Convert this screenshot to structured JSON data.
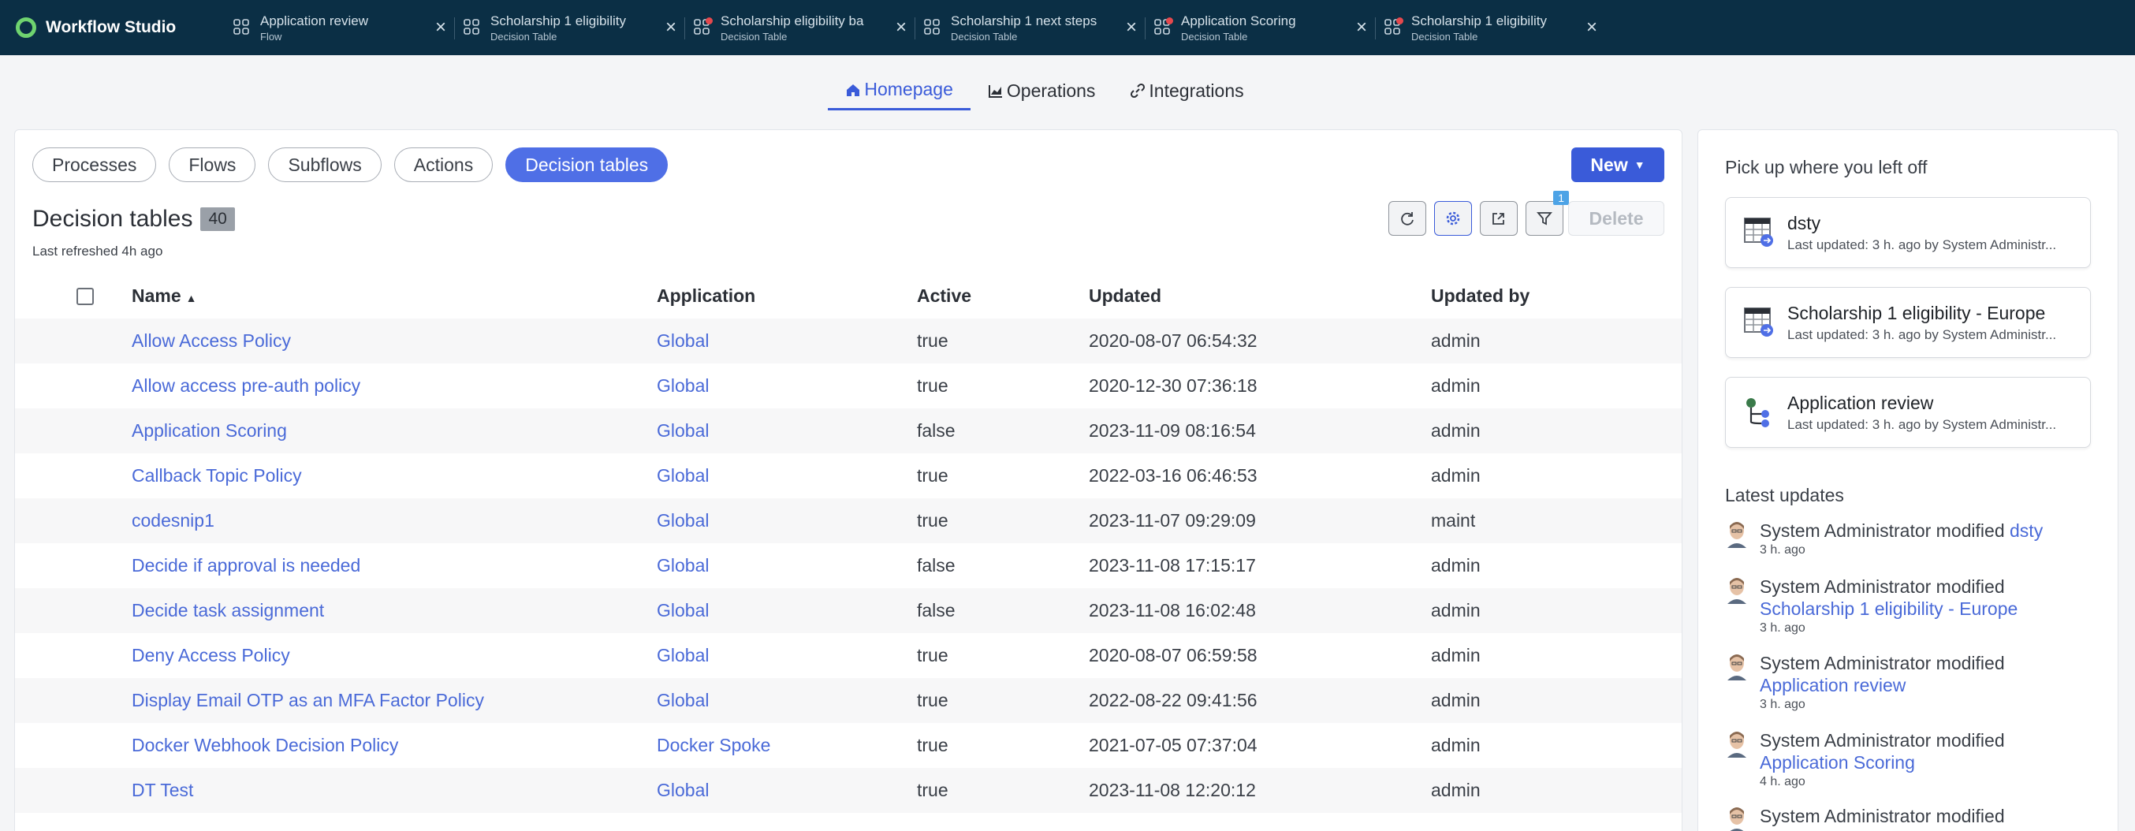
{
  "app": {
    "name": "Workflow Studio"
  },
  "tabs": [
    {
      "title": "Application review",
      "subtitle": "Flow",
      "icon": "flow-icon",
      "dot": false
    },
    {
      "title": "Scholarship 1 eligibility",
      "subtitle": "Decision Table",
      "icon": "decision-table-icon",
      "dot": false
    },
    {
      "title": "Scholarship eligibility ba",
      "subtitle": "Decision Table",
      "icon": "decision-table-icon",
      "dot": true
    },
    {
      "title": "Scholarship 1 next steps",
      "subtitle": "Decision Table",
      "icon": "decision-table-icon",
      "dot": false
    },
    {
      "title": "Application Scoring",
      "subtitle": "Decision Table",
      "icon": "decision-table-icon",
      "dot": true
    },
    {
      "title": "Scholarship 1 eligibility",
      "subtitle": "Decision Table",
      "icon": "decision-table-icon",
      "dot": true
    }
  ],
  "nav": {
    "items": [
      {
        "label": "Homepage",
        "icon": "home-icon",
        "active": true
      },
      {
        "label": "Operations",
        "icon": "chart-icon",
        "active": false
      },
      {
        "label": "Integrations",
        "icon": "link-icon",
        "active": false
      }
    ]
  },
  "filters": {
    "pills": [
      "Processes",
      "Flows",
      "Subflows",
      "Actions",
      "Decision tables"
    ],
    "active": "Decision tables"
  },
  "toolbar": {
    "new_label": "New",
    "delete_label": "Delete",
    "filter_count": "1"
  },
  "list": {
    "title": "Decision tables",
    "count": "40",
    "last_refreshed": "Last refreshed 4h ago",
    "columns": {
      "name": "Name",
      "application": "Application",
      "active": "Active",
      "updated": "Updated",
      "updated_by": "Updated by"
    },
    "rows": [
      {
        "name": "Allow Access Policy",
        "application": "Global",
        "active": "true",
        "updated": "2020-08-07 06:54:32",
        "updated_by": "admin"
      },
      {
        "name": "Allow access pre-auth policy",
        "application": "Global",
        "active": "true",
        "updated": "2020-12-30 07:36:18",
        "updated_by": "admin"
      },
      {
        "name": "Application Scoring",
        "application": "Global",
        "active": "false",
        "updated": "2023-11-09 08:16:54",
        "updated_by": "admin"
      },
      {
        "name": "Callback Topic Policy",
        "application": "Global",
        "active": "true",
        "updated": "2022-03-16 06:46:53",
        "updated_by": "admin"
      },
      {
        "name": "codesnip1",
        "application": "Global",
        "active": "true",
        "updated": "2023-11-07 09:29:09",
        "updated_by": "maint"
      },
      {
        "name": "Decide if approval is needed",
        "application": "Global",
        "active": "false",
        "updated": "2023-11-08 17:15:17",
        "updated_by": "admin"
      },
      {
        "name": "Decide task assignment",
        "application": "Global",
        "active": "false",
        "updated": "2023-11-08 16:02:48",
        "updated_by": "admin"
      },
      {
        "name": "Deny Access Policy",
        "application": "Global",
        "active": "true",
        "updated": "2020-08-07 06:59:58",
        "updated_by": "admin"
      },
      {
        "name": "Display Email OTP as an MFA Factor Policy",
        "application": "Global",
        "active": "true",
        "updated": "2022-08-22 09:41:56",
        "updated_by": "admin"
      },
      {
        "name": "Docker Webhook Decision Policy",
        "application": "Docker Spoke",
        "active": "true",
        "updated": "2021-07-05 07:37:04",
        "updated_by": "admin"
      },
      {
        "name": "DT Test",
        "application": "Global",
        "active": "true",
        "updated": "2023-11-08 12:20:12",
        "updated_by": "admin"
      }
    ]
  },
  "side": {
    "heading": "Pick up where you left off",
    "cards": [
      {
        "title": "dsty",
        "meta": "Last updated: 3 h. ago by System Administr...",
        "icon": "decision-table-icon"
      },
      {
        "title": "Scholarship 1 eligibility - Europe",
        "meta": "Last updated: 3 h. ago by System Administr...",
        "icon": "decision-table-icon"
      },
      {
        "title": "Application review",
        "meta": "Last updated: 3 h. ago by System Administr...",
        "icon": "flow-icon"
      }
    ],
    "updates_heading": "Latest updates",
    "updates": [
      {
        "actor": "System Administrator modified",
        "target": "dsty",
        "time": "3 h. ago"
      },
      {
        "actor": "System Administrator modified",
        "target": "Scholarship 1 eligibility - Europe",
        "time": "3 h. ago"
      },
      {
        "actor": "System Administrator modified",
        "target": "Application review",
        "time": "3 h. ago"
      },
      {
        "actor": "System Administrator modified",
        "target": "Application Scoring",
        "time": "4 h. ago"
      },
      {
        "actor": "System Administrator modified",
        "target": "",
        "time": ""
      }
    ]
  },
  "colors": {
    "topbar": "#0b2f45",
    "accent": "#3a5bd9",
    "link": "#4a6ad8",
    "brand_logo": "#6fd36f"
  }
}
